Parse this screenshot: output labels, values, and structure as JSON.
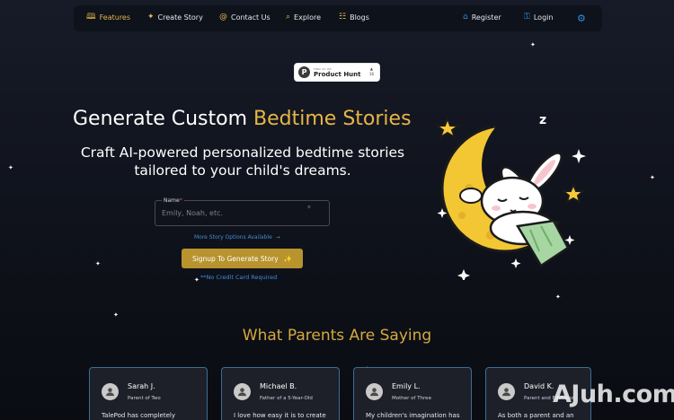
{
  "nav": {
    "items": [
      {
        "label": "Features",
        "icon": "book-icon"
      },
      {
        "label": "Create Story",
        "icon": "magic-wand-icon"
      },
      {
        "label": "Contact Us",
        "icon": "at-icon"
      },
      {
        "label": "Explore",
        "icon": "search-icon"
      },
      {
        "label": "Blogs",
        "icon": "document-icon"
      },
      {
        "label": "Register",
        "icon": "lock-icon"
      },
      {
        "label": "Login",
        "icon": "key-icon"
      }
    ],
    "settings_icon": "gear-icon"
  },
  "product_hunt": {
    "small": "FIND US ON",
    "big": "Product Hunt",
    "votes": "16"
  },
  "hero": {
    "title_plain": "Generate Custom ",
    "title_highlight": "Bedtime Stories",
    "subtitle": "Craft AI-powered personalized bedtime stories tailored to your child's dreams."
  },
  "form": {
    "name_label": "Name",
    "required_mark": "*",
    "name_placeholder": "Emily, Noah, etc.",
    "more_options": "More Story Options Available",
    "more_arrow": "→",
    "cta_label": "Signup To Generate Story",
    "no_credit": "**No Credit Card Required"
  },
  "testimonials": {
    "heading": "What Parents Are Saying",
    "cards": [
      {
        "name": "Sarah J.",
        "role": "Parent of Two",
        "quote": "TalePod has completely"
      },
      {
        "name": "Michael B.",
        "role": "Father of a 5-Year-Old",
        "quote": "I love how easy it is to create"
      },
      {
        "name": "Emily L.",
        "role": "Mother of Three",
        "quote": "My children's imagination has"
      },
      {
        "name": "David K.",
        "role": "Parent and Educator",
        "quote": "As both a parent and an"
      }
    ]
  },
  "watermark": "AJuh.com",
  "colors": {
    "accent_gold": "#e5b646",
    "link_blue": "#3b8ed9",
    "button_gold": "#b8932e",
    "card_border": "#3d6d93"
  }
}
